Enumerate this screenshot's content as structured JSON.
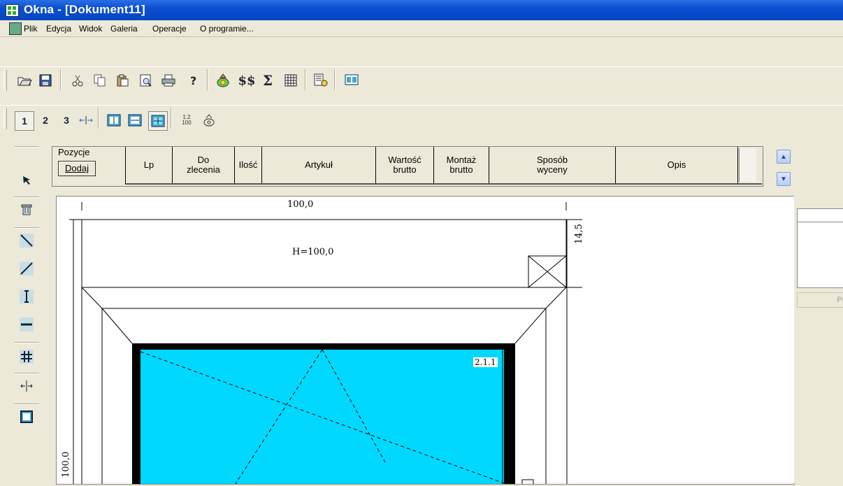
{
  "window": {
    "title": "Okna - [Dokument11]"
  },
  "menu": {
    "items": [
      "Plik",
      "Edycja",
      "Widok",
      "Galeria",
      "Operacje",
      "O programie..."
    ]
  },
  "toolbar1": {
    "icons": [
      "open-icon",
      "save-icon",
      "cut-icon",
      "copy-icon",
      "paste-icon",
      "preview-icon",
      "print-icon",
      "help-icon",
      "money-bag-icon",
      "price-icon",
      "sum-icon",
      "table-icon",
      "export-icon",
      "calc-icon"
    ],
    "price_label": "$$",
    "sum_label": "Σ"
  },
  "toolbar2": {
    "labels": [
      "1",
      "2",
      "3"
    ],
    "ratio_label": "1:2\n100"
  },
  "header": {
    "pozycje": "Pozycje",
    "dodaj": "Dodaj",
    "columns": [
      "Lp",
      "Do\nzlecenia",
      "Ilość",
      "Artykuł",
      "Wartość\nbrutto",
      "Montaż\nbrutto",
      "Sposób\nwyceny",
      "Opis"
    ]
  },
  "drawing": {
    "width_dim": "100,0",
    "height_label": "H=100,0",
    "top_dim": "14,5",
    "left_dim": "100,0",
    "sash_label": "2.1.1"
  },
  "colors": {
    "glass": "#00d8ff",
    "title_bg": "#0a4fd0"
  },
  "rightpanel": {
    "button_label": "Po"
  }
}
